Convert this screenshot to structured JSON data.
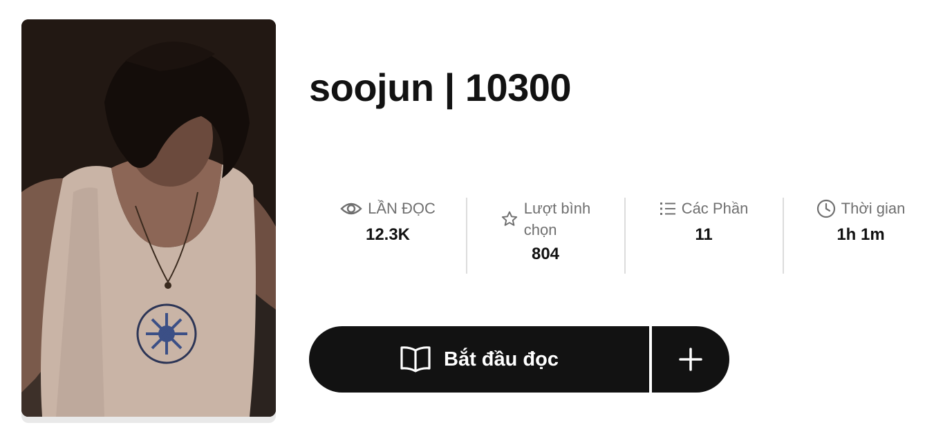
{
  "story": {
    "title": "soojun | 10300"
  },
  "stats": [
    {
      "label": "LẦN ĐỌC",
      "value": "12.3K",
      "icon": "eye-icon"
    },
    {
      "label_line1": "Lượt bình",
      "label_line2": "chọn",
      "value": "804",
      "icon": "star-icon"
    },
    {
      "label": "Các Phần",
      "value": "11",
      "icon": "list-icon"
    },
    {
      "label": "Thời gian",
      "value": "1h 1m",
      "icon": "clock-icon"
    }
  ],
  "actions": {
    "read_label": "Bắt đầu đọc",
    "read_icon": "book-open-icon",
    "add_icon": "plus-icon"
  },
  "colors": {
    "primary": "#121212",
    "muted_text": "#6f6f6f",
    "divider": "#dcdcdc"
  }
}
